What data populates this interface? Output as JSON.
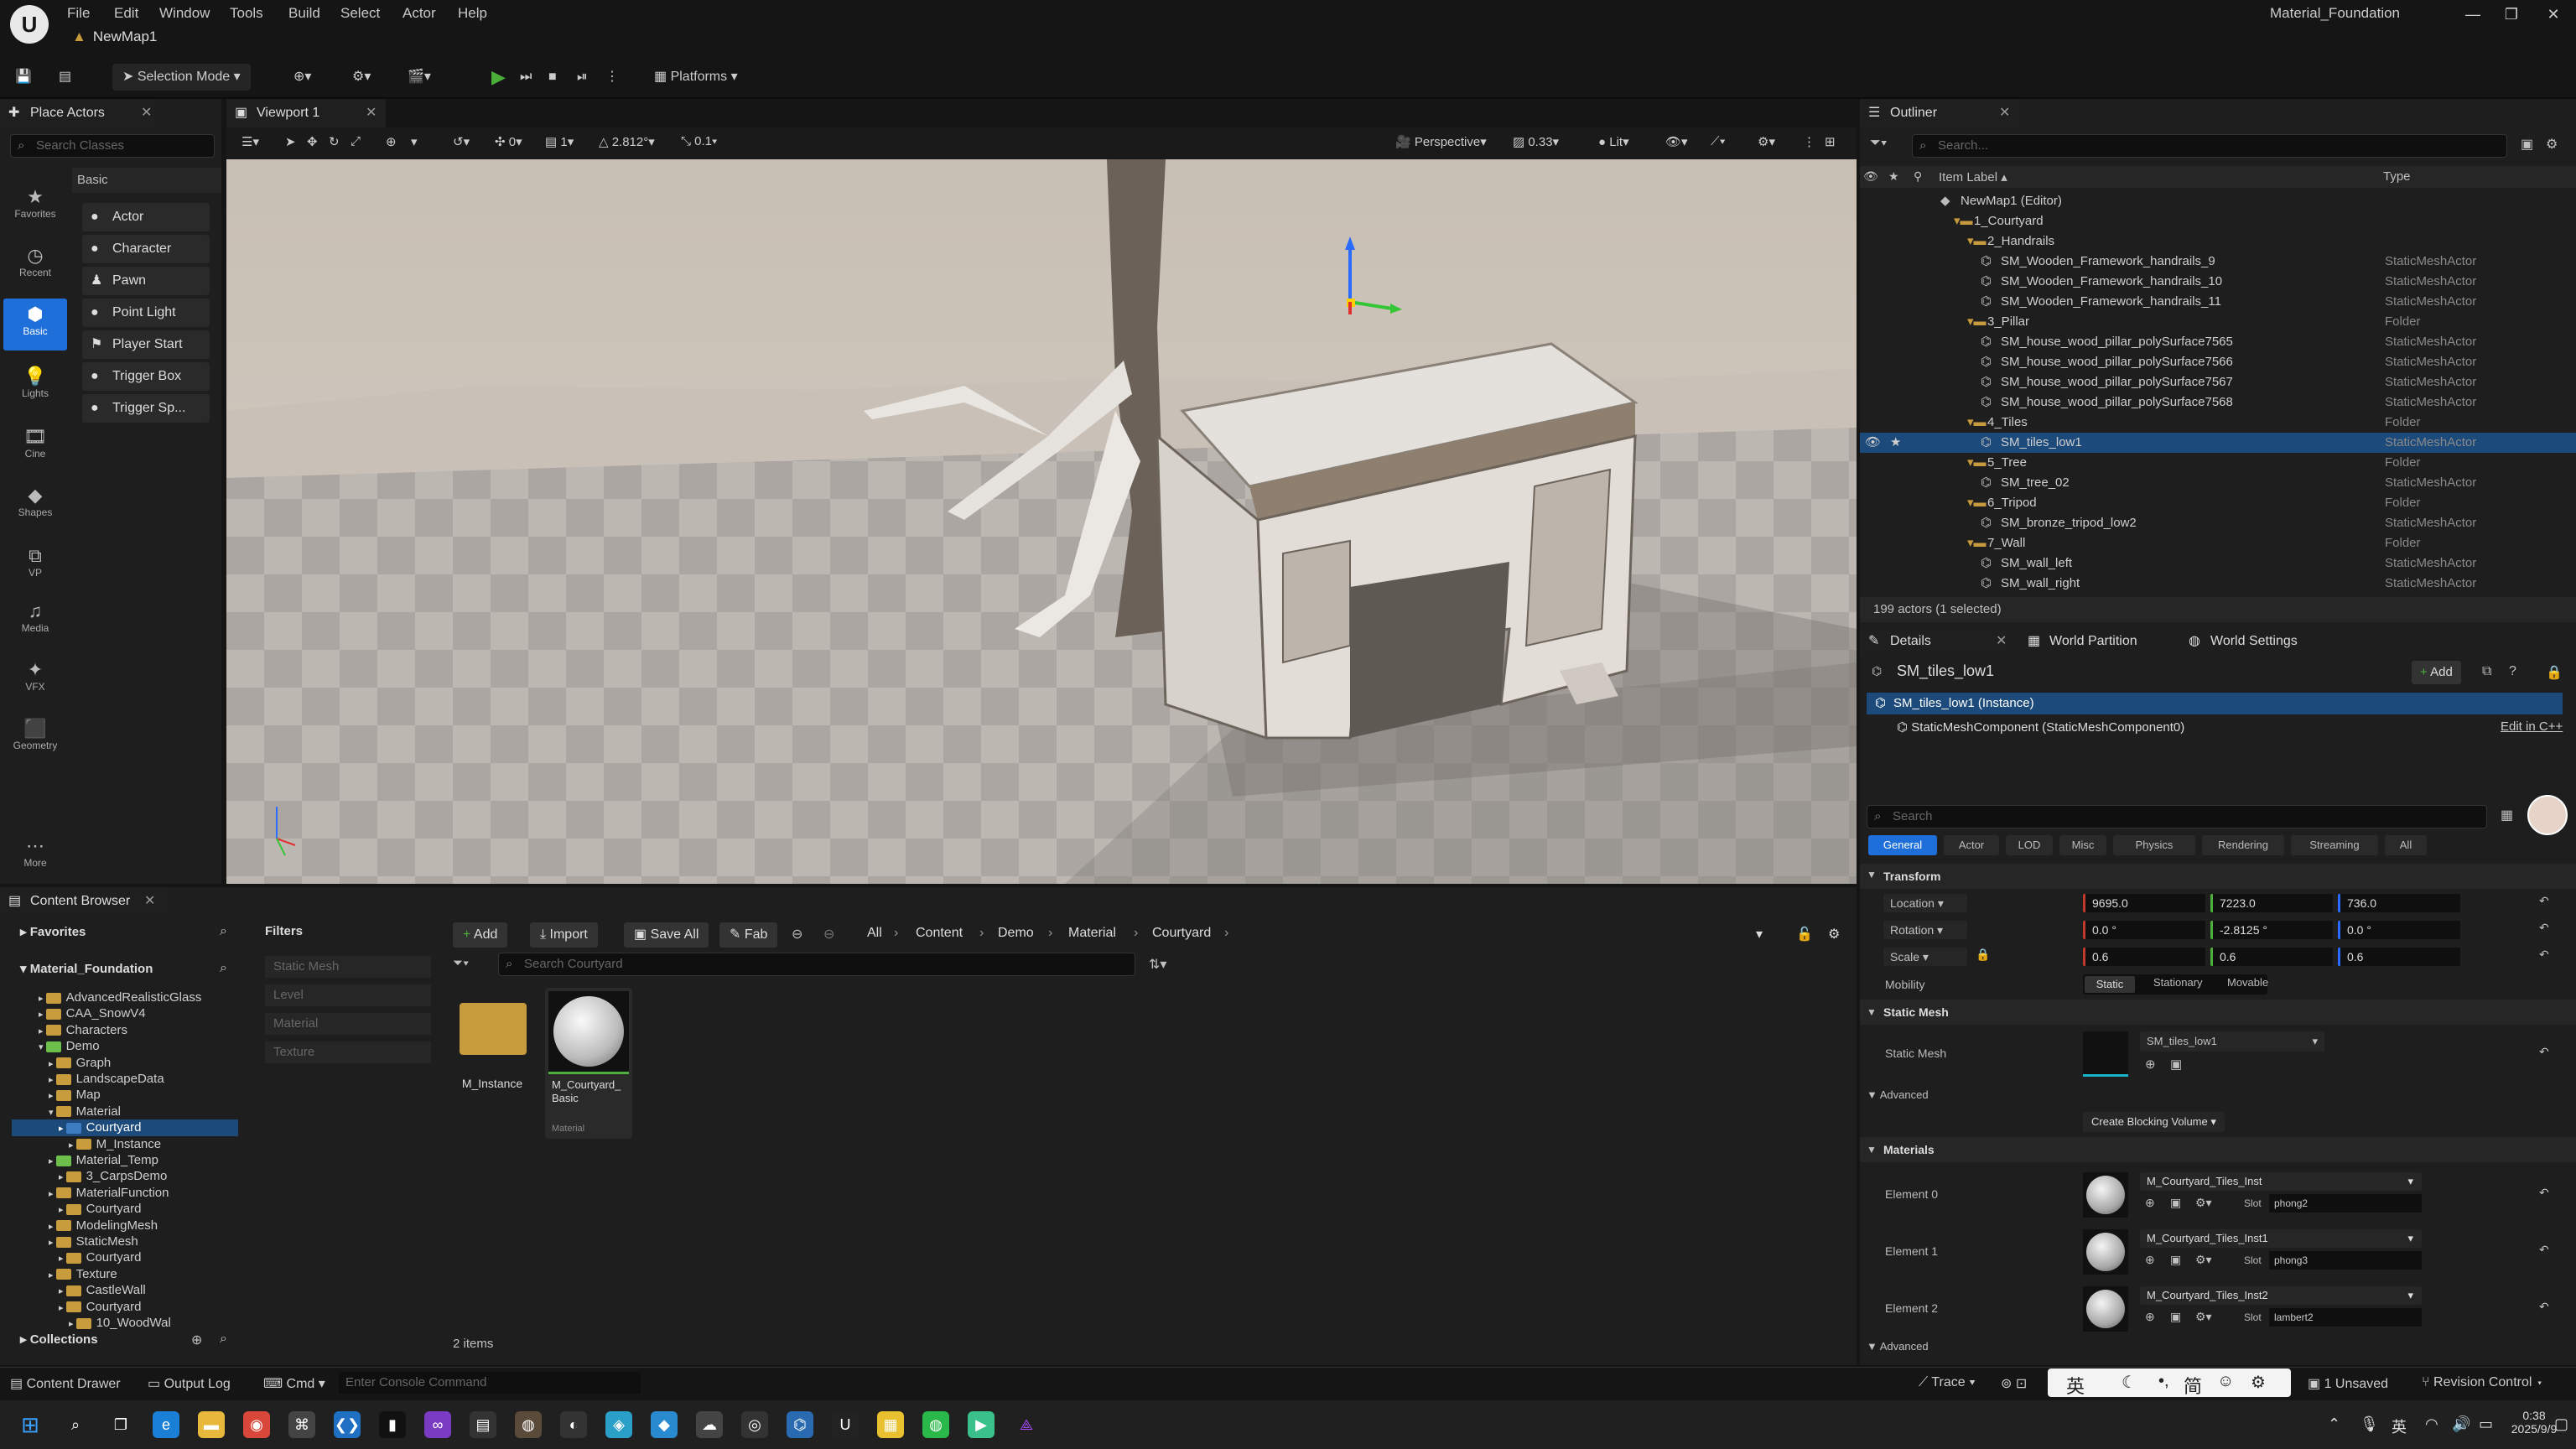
{
  "app": {
    "window_title": "Material_Foundation",
    "map_tab": "NewMap1",
    "menu": [
      "File",
      "Edit",
      "Window",
      "Tools",
      "Build",
      "Select",
      "Actor",
      "Help"
    ]
  },
  "toolbar": {
    "selection_mode": "Selection Mode",
    "platforms": "Platforms"
  },
  "place_actors": {
    "tab": "Place Actors",
    "search_placeholder": "Search Classes",
    "section": "Basic",
    "categories": [
      "Favorites",
      "Recent",
      "Basic",
      "Lights",
      "Cine",
      "Shapes",
      "VP",
      "Media",
      "VFX",
      "Geometry",
      "More"
    ],
    "items": [
      "Actor",
      "Character",
      "Pawn",
      "Point Light",
      "Player Start",
      "Trigger Box",
      "Trigger Sp..."
    ]
  },
  "viewport": {
    "tab": "Viewport 1",
    "grid_value": "0",
    "rotation_snap": "1",
    "angle": "2.812°",
    "scale_snap": "0.1",
    "perspective": "Perspective",
    "camera_speed": "0.33",
    "lit": "Lit"
  },
  "outliner": {
    "tab": "Outliner",
    "search_placeholder": "Search...",
    "col_label": "Item Label",
    "col_type": "Type",
    "rows": [
      {
        "label": "NewMap1 (Editor)",
        "type": "",
        "indent": 0
      },
      {
        "label": "1_Courtyard",
        "type": "",
        "indent": 1,
        "folder": true
      },
      {
        "label": "2_Handrails",
        "type": "",
        "indent": 2,
        "folder": true
      },
      {
        "label": "SM_Wooden_Framework_handrails_9",
        "type": "StaticMeshActor",
        "indent": 3
      },
      {
        "label": "SM_Wooden_Framework_handrails_10",
        "type": "StaticMeshActor",
        "indent": 3
      },
      {
        "label": "SM_Wooden_Framework_handrails_11",
        "type": "StaticMeshActor",
        "indent": 3
      },
      {
        "label": "3_Pillar",
        "type": "Folder",
        "indent": 2,
        "folder": true
      },
      {
        "label": "SM_house_wood_pillar_polySurface7565",
        "type": "StaticMeshActor",
        "indent": 3
      },
      {
        "label": "SM_house_wood_pillar_polySurface7566",
        "type": "StaticMeshActor",
        "indent": 3
      },
      {
        "label": "SM_house_wood_pillar_polySurface7567",
        "type": "StaticMeshActor",
        "indent": 3
      },
      {
        "label": "SM_house_wood_pillar_polySurface7568",
        "type": "StaticMeshActor",
        "indent": 3
      },
      {
        "label": "4_Tiles",
        "type": "Folder",
        "indent": 2,
        "folder": true
      },
      {
        "label": "SM_tiles_low1",
        "type": "StaticMeshActor",
        "indent": 3,
        "selected": true
      },
      {
        "label": "5_Tree",
        "type": "Folder",
        "indent": 2,
        "folder": true
      },
      {
        "label": "SM_tree_02",
        "type": "StaticMeshActor",
        "indent": 3
      },
      {
        "label": "6_Tripod",
        "type": "Folder",
        "indent": 2,
        "folder": true
      },
      {
        "label": "SM_bronze_tripod_low2",
        "type": "StaticMeshActor",
        "indent": 3
      },
      {
        "label": "7_Wall",
        "type": "Folder",
        "indent": 2,
        "folder": true
      },
      {
        "label": "SM_wall_left",
        "type": "StaticMeshActor",
        "indent": 3
      },
      {
        "label": "SM_wall_right",
        "type": "StaticMeshActor",
        "indent": 3
      }
    ],
    "status": "199 actors (1 selected)"
  },
  "details": {
    "tabs": [
      "Details",
      "World Partition",
      "World Settings"
    ],
    "object_name": "SM_tiles_low1",
    "add_label": "Add",
    "instance": "SM_tiles_low1 (Instance)",
    "component": "StaticMeshComponent (StaticMeshComponent0)",
    "edit_cpp": "Edit in C++",
    "search_placeholder": "Search",
    "filter_tabs": [
      "General",
      "Actor",
      "LOD",
      "Misc",
      "Physics",
      "Rendering",
      "Streaming",
      "All"
    ],
    "transform": {
      "section": "Transform",
      "location_label": "Location",
      "location": [
        "9695.0",
        "7223.0",
        "736.0"
      ],
      "rotation_label": "Rotation",
      "rotation": [
        "0.0 °",
        "-2.8125 °",
        "0.0 °"
      ],
      "scale_label": "Scale",
      "scale": [
        "0.6",
        "0.6",
        "0.6"
      ],
      "mobility_label": "Mobility",
      "mobility": [
        "Static",
        "Stationary",
        "Movable"
      ]
    },
    "static_mesh": {
      "section": "Static Mesh",
      "label": "Static Mesh",
      "value": "SM_tiles_low1",
      "advanced": "Advanced",
      "blocking_volume": "Create Blocking Volume"
    },
    "materials": {
      "section": "Materials",
      "slot_label": "Slot",
      "elements": [
        {
          "label": "Element 0",
          "material": "M_Courtyard_Tiles_Inst",
          "slot": "phong2"
        },
        {
          "label": "Element 1",
          "material": "M_Courtyard_Tiles_Inst1",
          "slot": "phong3"
        },
        {
          "label": "Element 2",
          "material": "M_Courtyard_Tiles_Inst2",
          "slot": "lambert2"
        }
      ],
      "advanced": "Advanced"
    }
  },
  "content_browser": {
    "tab": "Content Browser",
    "favorites": "Favorites",
    "project": "Material_Foundation",
    "filters": "Filters",
    "filter_items": [
      "Static Mesh",
      "Level",
      "Material",
      "Texture"
    ],
    "buttons": {
      "add": "Add",
      "import": "Import",
      "save_all": "Save All",
      "fab": "Fab"
    },
    "breadcrumb": [
      "All",
      "Content",
      "Demo",
      "Material",
      "Courtyard"
    ],
    "search_placeholder": "Search Courtyard",
    "tree": [
      {
        "label": "AdvancedRealisticGlass",
        "indent": 1
      },
      {
        "label": "CAA_SnowV4",
        "indent": 1
      },
      {
        "label": "Characters",
        "indent": 1
      },
      {
        "label": "Demo",
        "indent": 1,
        "color": "green",
        "open": true
      },
      {
        "label": "Graph",
        "indent": 2
      },
      {
        "label": "LandscapeData",
        "indent": 2
      },
      {
        "label": "Map",
        "indent": 2
      },
      {
        "label": "Material",
        "indent": 2,
        "open": true
      },
      {
        "label": "Courtyard",
        "indent": 3,
        "selected": true,
        "color": "blue"
      },
      {
        "label": "M_Instance",
        "indent": 4
      },
      {
        "label": "Material_Temp",
        "indent": 2,
        "color": "green"
      },
      {
        "label": "3_CarpsDemo",
        "indent": 3
      },
      {
        "label": "MaterialFunction",
        "indent": 2
      },
      {
        "label": "Courtyard",
        "indent": 3
      },
      {
        "label": "ModelingMesh",
        "indent": 2
      },
      {
        "label": "StaticMesh",
        "indent": 2
      },
      {
        "label": "Courtyard",
        "indent": 3
      },
      {
        "label": "Texture",
        "indent": 2
      },
      {
        "label": "CastleWall",
        "indent": 3
      },
      {
        "label": "Courtyard",
        "indent": 3
      },
      {
        "label": "10_WoodWal",
        "indent": 4
      }
    ],
    "assets": [
      {
        "name": "M_Instance",
        "kind": "folder"
      },
      {
        "name": "M_Courtyard_\nBasic",
        "kind": "material",
        "sub": "Material"
      }
    ],
    "item_count": "2 items",
    "collections": "Collections"
  },
  "statusbar": {
    "content_drawer": "Content Drawer",
    "output_log": "Output Log",
    "cmd": "Cmd",
    "console_placeholder": "Enter Console Command",
    "trace": "Trace",
    "unsaved": "1 Unsaved",
    "revision": "Revision Control"
  },
  "taskbar": {
    "time": "0:38",
    "date": "2025/9/9",
    "ime": "英",
    "ime2": "简"
  },
  "colors": {
    "accent_blue": "#1c4a7a",
    "play_green": "#4caf3a",
    "folder_yellow": "#c89c3c"
  }
}
